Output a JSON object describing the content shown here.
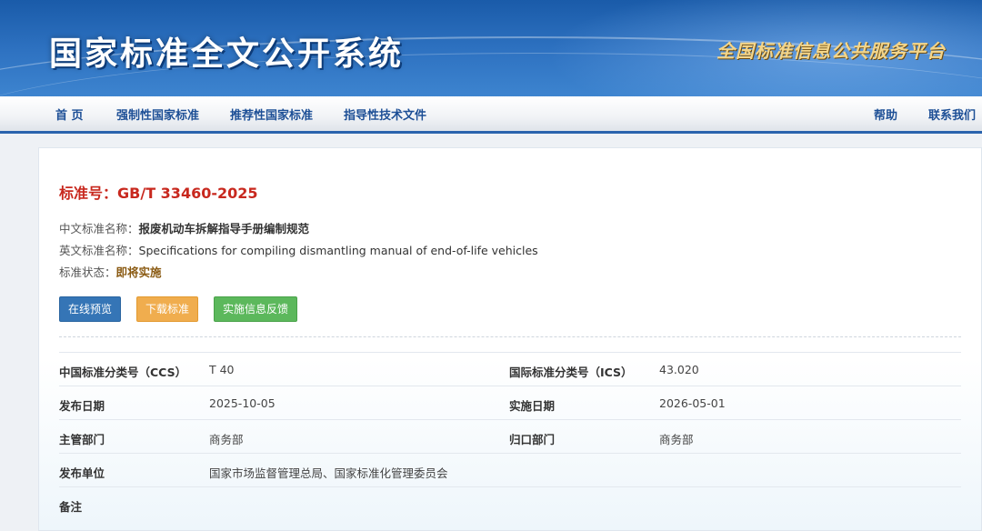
{
  "banner": {
    "title": "国家标准全文公开系统",
    "platform": "全国标准信息公共服务平台"
  },
  "nav": {
    "home": "首 页",
    "mandatory": "强制性国家标准",
    "recommended": "推荐性国家标准",
    "guidance": "指导性技术文件",
    "help": "帮助",
    "contact": "联系我们"
  },
  "standard": {
    "number_label": "标准号：",
    "number": "GB/T 33460-2025",
    "cn_name_label": "中文标准名称：",
    "cn_name": "报废机动车拆解指导手册编制规范",
    "en_name_label": "英文标准名称：",
    "en_name": "Specifications for compiling dismantling manual of end-of-life vehicles",
    "status_label": "标准状态：",
    "status": "即将实施"
  },
  "buttons": {
    "preview": "在线预览",
    "download": "下载标准",
    "feedback": "实施信息反馈"
  },
  "details": {
    "ccs_label": "中国标准分类号（CCS）",
    "ccs": "T 40",
    "ics_label": "国际标准分类号（ICS）",
    "ics": "43.020",
    "publish_date_label": "发布日期",
    "publish_date": "2025-10-05",
    "implement_date_label": "实施日期",
    "implement_date": "2026-05-01",
    "authority_label": "主管部门",
    "authority": "商务部",
    "owner_label": "归口部门",
    "owner": "商务部",
    "publisher_label": "发布单位",
    "publisher": "国家市场监督管理总局、国家标准化管理委员会",
    "remarks_label": "备注"
  },
  "colors": {
    "banner_blue": "#2f73c2",
    "nav_text": "#1d4f96",
    "std_number_red": "#c8281e",
    "status_brown": "#8a5a12",
    "btn_blue": "#3575b6",
    "btn_orange": "#f0ad4e",
    "btn_green": "#5cb85c"
  }
}
